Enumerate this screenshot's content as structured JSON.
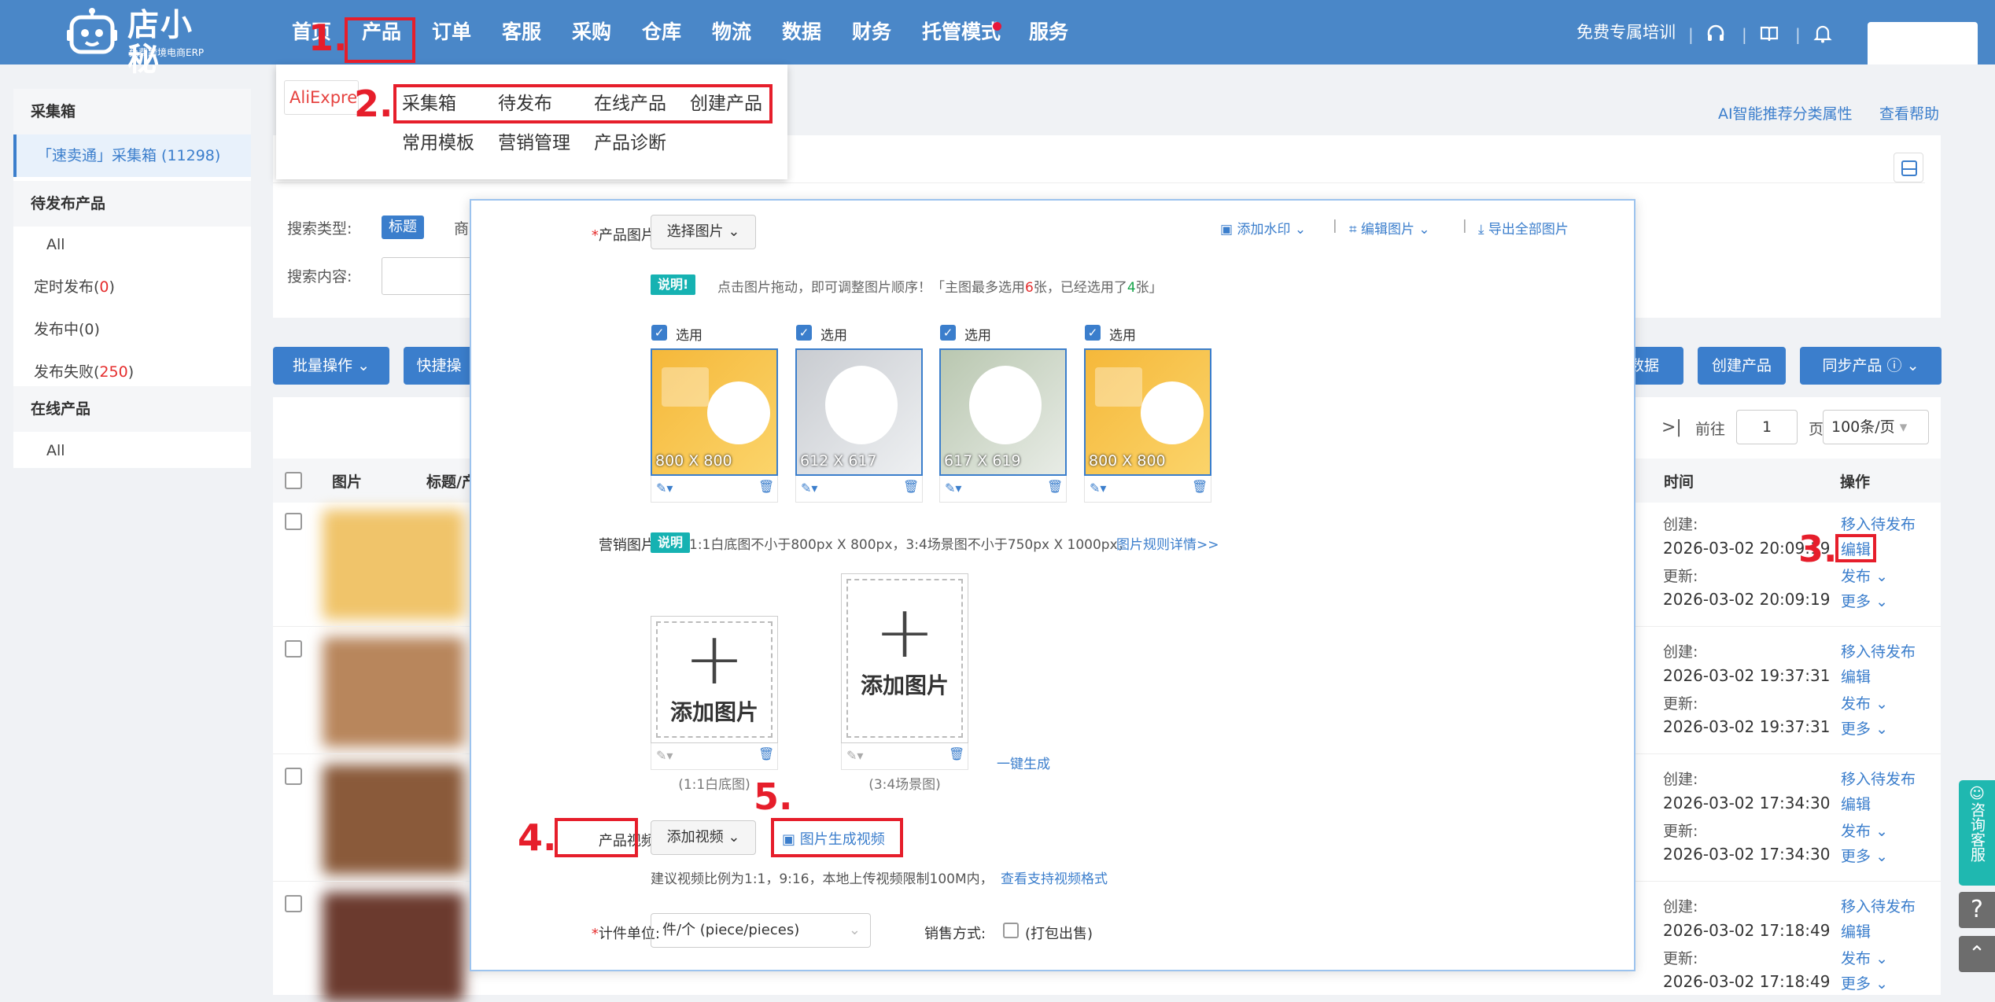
{
  "header": {
    "logo_name": "店小秘",
    "logo_sub": "免费跨境电商ERP",
    "nav": [
      "首页",
      "产品",
      "订单",
      "客服",
      "采购",
      "仓库",
      "物流",
      "数据",
      "财务",
      "托管模式",
      "服务"
    ],
    "training": "免费专属培训"
  },
  "sidebar": {
    "groups": [
      {
        "title": "采集箱",
        "items": [
          {
            "label": "「速卖通」采集箱 (11298)"
          }
        ]
      },
      {
        "title": "待发布产品",
        "items": [
          {
            "label": "All"
          },
          {
            "label": "定时发布(",
            "count": "0",
            "tail": ")"
          },
          {
            "label": "发布中(0)"
          },
          {
            "label": "发布失败(",
            "count": "250",
            "tail": ")"
          }
        ]
      },
      {
        "title": "在线产品",
        "items": [
          {
            "label": "All"
          }
        ]
      }
    ]
  },
  "main": {
    "top_links": [
      "AI智能推荐分类属性",
      "查看帮助"
    ],
    "search_type_label": "搜索类型:",
    "search_type_active": "标题",
    "search_type_next": "商",
    "search_content_label": "搜索内容:",
    "batch_btn": "批量操作",
    "quick_btn": "快捷操",
    "right_btn_partial": "数据",
    "create_btn": "创建产品",
    "sync_btn": "同步产品",
    "pager_goto": "前往",
    "pager_page": "1",
    "pager_unit": "页",
    "pager_size": "100条/页",
    "col_image": "图片",
    "col_title": "标题/产",
    "col_time": "时间",
    "col_ops": "操作",
    "rows": [
      {
        "created_label": "创建:",
        "created": "2026-03-02 20:09:19",
        "updated_label": "更新:",
        "updated": "2026-03-02 20:09:19"
      },
      {
        "created_label": "创建:",
        "created": "2026-03-02 19:37:31",
        "updated_label": "更新:",
        "updated": "2026-03-02 19:37:31"
      },
      {
        "created_label": "创建:",
        "created": "2026-03-02 17:34:30",
        "updated_label": "更新:",
        "updated": "2026-03-02 17:34:30"
      },
      {
        "created_label": "创建:",
        "created": "2026-03-02 17:18:49",
        "updated_label": "更新:",
        "updated": "2026-03-02 17:18:49"
      }
    ],
    "ops": {
      "move": "移入待发布",
      "edit": "编辑",
      "publish": "发布",
      "more": "更多"
    }
  },
  "dropdown": {
    "platform": "AliExpress",
    "row1": [
      "采集箱",
      "待发布",
      "在线产品",
      "创建产品"
    ],
    "row2": [
      "常用模板",
      "营销管理",
      "产品诊断"
    ]
  },
  "modal": {
    "product_images_label": "产品图片:",
    "select_images": "选择图片",
    "watermark": "添加水印",
    "edit_images": "编辑图片",
    "export_images": "导出全部图片",
    "note_tag": "说明!",
    "note_text_a": "点击图片拖动，即可调整图片顺序！「主图最多选用",
    "note_max": "6",
    "note_text_b": "张，已经选用了",
    "note_used": "4",
    "note_text_c": "张」",
    "select_label": "选用",
    "images": [
      {
        "dim": "800 X 800",
        "style": "promo"
      },
      {
        "dim": "612 X 617",
        "style": "photo"
      },
      {
        "dim": "617 X 619",
        "style": "photo"
      },
      {
        "dim": "800 X 800",
        "style": "promo"
      }
    ],
    "marketing_label": "营销图片:",
    "marketing_tag": "说明",
    "marketing_note": "1:1白底图不小于800px X 800px，3:4场景图不小于750px X 1000px，",
    "marketing_link": "图片规则详情>>",
    "add_image": "添加图片",
    "cap_1_1": "(1:1白底图)",
    "cap_3_4": "(3:4场景图)",
    "one_click": "一键生成",
    "video_label": "产品视频:",
    "add_video": "添加视频",
    "img_to_video": "图片生成视频",
    "video_note": "建议视频比例为1:1，9:16，本地上传视频限制100M内，",
    "video_link": "查看支持视频格式",
    "unit_label": "计件单位:",
    "unit_value": "件/个 (piece/pieces)",
    "sale_label": "销售方式:",
    "sale_opt": "(打包出售)"
  },
  "annotations": [
    "1.",
    "2.",
    "3.",
    "4.",
    "5."
  ],
  "float": {
    "consult": "咨询客服"
  },
  "colors": {
    "primary": "#3b7ecc",
    "header": "#4a87c8",
    "annotation": "#e61e2b",
    "teal": "#16b2b2"
  }
}
